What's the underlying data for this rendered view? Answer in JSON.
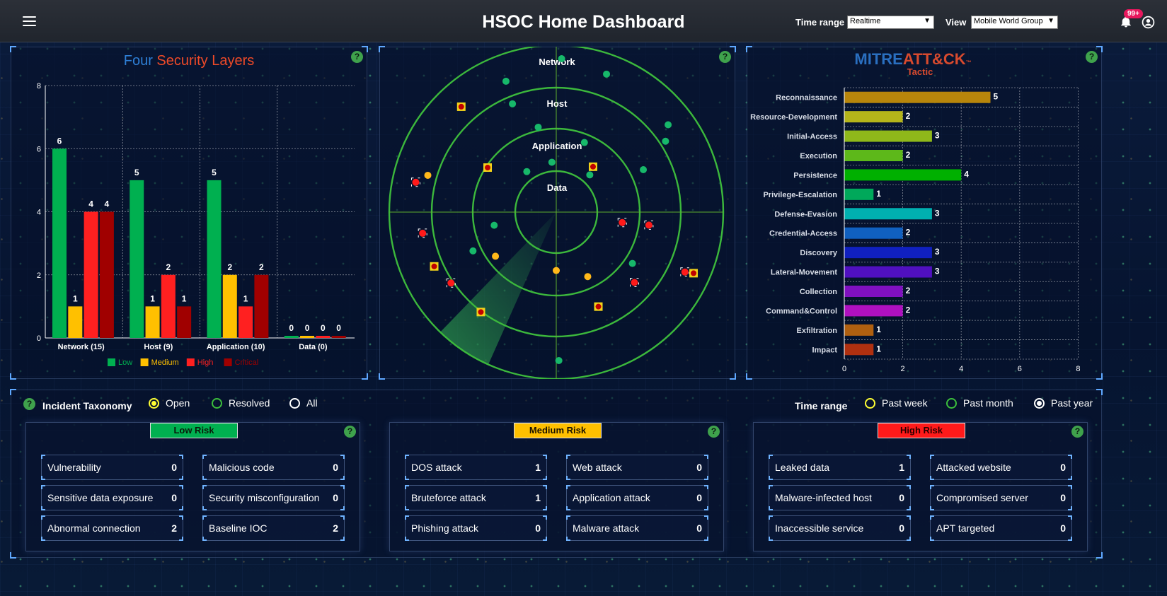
{
  "header": {
    "title": "HSOC Home Dashboard",
    "time_range_label": "Time range",
    "time_range_value": "Realtime",
    "view_label": "View",
    "view_value": "Mobile World Group",
    "notification_count": "99+"
  },
  "security_layers": {
    "title_part1": "Four",
    "title_part2": "Security Layers"
  },
  "radar": {
    "ring_labels": [
      "Network",
      "Host",
      "Application",
      "Data"
    ]
  },
  "mitre": {
    "logo_part1": "MITRE",
    "logo_part2": "ATT&CK",
    "logo_tm": "™",
    "subtitle": "Tactic"
  },
  "chart_data": [
    {
      "type": "bar",
      "categories": [
        "Network (15)",
        "Host (9)",
        "Application (10)",
        "Data (0)"
      ],
      "series": [
        {
          "name": "Low",
          "color": "#00b050",
          "values": [
            6,
            5,
            5,
            0
          ]
        },
        {
          "name": "Medium",
          "color": "#ffc000",
          "values": [
            1,
            1,
            2,
            0
          ]
        },
        {
          "name": "High",
          "color": "#ff2020",
          "values": [
            4,
            2,
            1,
            0
          ]
        },
        {
          "name": "Critical",
          "color": "#a00000",
          "values": [
            4,
            1,
            2,
            0
          ]
        }
      ],
      "ylim": [
        0,
        8
      ],
      "yticks": [
        0,
        2,
        4,
        6,
        8
      ],
      "grid": true,
      "legend": "bottom"
    },
    {
      "type": "bar",
      "orientation": "horizontal",
      "categories": [
        "Reconnaissance",
        "Resource-Development",
        "Initial-Access",
        "Execution",
        "Persistence",
        "Privilege-Escalation",
        "Defense-Evasion",
        "Credential-Access",
        "Discovery",
        "Lateral-Movement",
        "Collection",
        "Command&Control",
        "Exfiltration",
        "Impact"
      ],
      "values": [
        5,
        2,
        3,
        2,
        4,
        1,
        3,
        2,
        3,
        3,
        2,
        2,
        1,
        1
      ],
      "colors": [
        "#b8860b",
        "#b5b51a",
        "#8fb81a",
        "#5db81a",
        "#00b000",
        "#00a85a",
        "#00b0b0",
        "#1060c0",
        "#1020c0",
        "#5010c0",
        "#8010c0",
        "#b010c0",
        "#b06010",
        "#b03010"
      ],
      "xlim": [
        0,
        8
      ],
      "xticks": [
        0,
        2,
        4,
        6,
        8
      ],
      "grid": true
    },
    {
      "type": "scatter",
      "name": "radar",
      "points": [
        {
          "kind": "low",
          "r": 0.92,
          "a": 88
        },
        {
          "kind": "low",
          "r": 0.88,
          "a": 70
        },
        {
          "kind": "low",
          "r": 0.84,
          "a": 111
        },
        {
          "kind": "low",
          "r": 0.7,
          "a": 112
        },
        {
          "kind": "low",
          "r": 0.85,
          "a": 38
        },
        {
          "kind": "low",
          "r": 0.78,
          "a": 33
        },
        {
          "kind": "low",
          "r": 0.52,
          "a": 102
        },
        {
          "kind": "low",
          "r": 0.45,
          "a": 68
        },
        {
          "kind": "low",
          "r": 0.3,
          "a": 95
        },
        {
          "kind": "low",
          "r": 0.3,
          "a": 126
        },
        {
          "kind": "low",
          "r": 0.3,
          "a": 48
        },
        {
          "kind": "low",
          "r": 0.58,
          "a": 26
        },
        {
          "kind": "low",
          "r": 0.38,
          "a": 192
        },
        {
          "kind": "low",
          "r": 0.55,
          "a": 205
        },
        {
          "kind": "low",
          "r": 0.55,
          "a": 326
        },
        {
          "kind": "low",
          "r": 0.89,
          "a": 271
        },
        {
          "kind": "med",
          "r": 0.8,
          "a": 164
        },
        {
          "kind": "med",
          "r": 0.45,
          "a": 216
        },
        {
          "kind": "med",
          "r": 0.35,
          "a": 270
        },
        {
          "kind": "med",
          "r": 0.43,
          "a": 296
        },
        {
          "kind": "high",
          "r": 0.86,
          "a": 168
        },
        {
          "kind": "high",
          "r": 0.81,
          "a": 189
        },
        {
          "kind": "high",
          "r": 0.76,
          "a": 214
        },
        {
          "kind": "high",
          "r": 0.4,
          "a": 351
        },
        {
          "kind": "high",
          "r": 0.56,
          "a": 352
        },
        {
          "kind": "high",
          "r": 0.63,
          "a": 318
        },
        {
          "kind": "high",
          "r": 0.85,
          "a": 335
        },
        {
          "kind": "crit",
          "r": 0.85,
          "a": 132
        },
        {
          "kind": "crit",
          "r": 0.49,
          "a": 147
        },
        {
          "kind": "crit",
          "r": 0.35,
          "a": 51
        },
        {
          "kind": "crit",
          "r": 0.8,
          "a": 204
        },
        {
          "kind": "crit",
          "r": 0.75,
          "a": 233
        },
        {
          "kind": "crit",
          "r": 0.62,
          "a": 294
        },
        {
          "kind": "crit",
          "r": 0.9,
          "a": 336
        }
      ]
    }
  ],
  "taxonomy": {
    "title": "Incident Taxonomy",
    "status_options": [
      {
        "label": "Open",
        "selected": true,
        "color": "#ffff33"
      },
      {
        "label": "Resolved",
        "selected": false,
        "color": "#3cbf3c"
      },
      {
        "label": "All",
        "selected": false,
        "color": "#ffffff"
      }
    ],
    "time_range_label": "Time range",
    "time_options": [
      {
        "label": "Past week",
        "selected": false,
        "color": "#ffff33"
      },
      {
        "label": "Past month",
        "selected": false,
        "color": "#3cbf3c"
      },
      {
        "label": "Past year",
        "selected": true,
        "color": "#ffffff"
      }
    ],
    "groups": [
      {
        "label": "Low Risk",
        "color": "#00b050",
        "text_color": "#0a1a0a",
        "items": [
          {
            "name": "Vulnerability",
            "value": "0"
          },
          {
            "name": "Malicious code",
            "value": "0"
          },
          {
            "name": "Sensitive data exposure",
            "value": "0"
          },
          {
            "name": "Security misconfiguration",
            "value": "0"
          },
          {
            "name": "Abnormal connection",
            "value": "2"
          },
          {
            "name": "Baseline IOC",
            "value": "2"
          }
        ]
      },
      {
        "label": "Medium Risk",
        "color": "#ffc000",
        "text_color": "#1a1200",
        "items": [
          {
            "name": "DOS attack",
            "value": "1"
          },
          {
            "name": "Web attack",
            "value": "0"
          },
          {
            "name": "Bruteforce attack",
            "value": "1"
          },
          {
            "name": "Application attack",
            "value": "0"
          },
          {
            "name": "Phishing attack",
            "value": "0"
          },
          {
            "name": "Malware attack",
            "value": "0"
          }
        ]
      },
      {
        "label": "High Risk",
        "color": "#ff1a1a",
        "text_color": "#2a0000",
        "items": [
          {
            "name": "Leaked data",
            "value": "1"
          },
          {
            "name": "Attacked website",
            "value": "0"
          },
          {
            "name": "Malware-infected host",
            "value": "0"
          },
          {
            "name": "Compromised server",
            "value": "0"
          },
          {
            "name": "Inaccessible service",
            "value": "0"
          },
          {
            "name": "APT targeted",
            "value": "0"
          }
        ]
      }
    ]
  }
}
